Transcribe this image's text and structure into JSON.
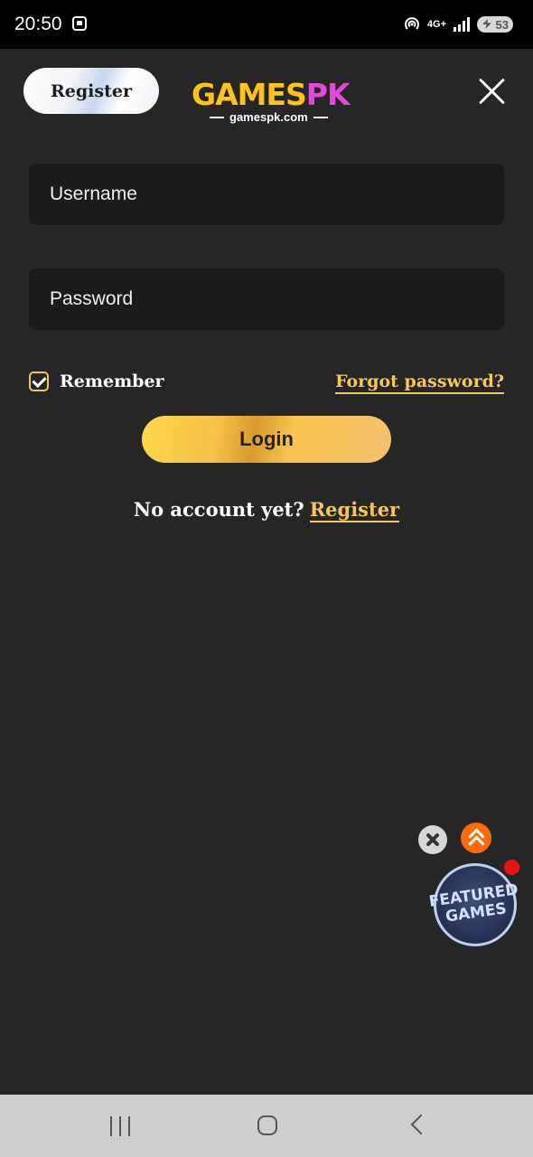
{
  "status_bar": {
    "time": "20:50",
    "network": "4G+",
    "battery": "53"
  },
  "header": {
    "register_label": "Register",
    "logo": {
      "part1": "GAMES",
      "part2": "PK",
      "domain": "gamespk.com"
    }
  },
  "form": {
    "username_placeholder": "Username",
    "password_placeholder": "Password",
    "remember_label": "Remember",
    "remember_checked": true,
    "forgot_label": "Forgot password?",
    "login_label": "Login",
    "no_account_text": "No account yet?",
    "register_link": "Register"
  },
  "floating": {
    "featured_line1": "FEATURED",
    "featured_line2": "GAMES"
  },
  "colors": {
    "background": "#262626",
    "field_bg": "#1b1b1b",
    "accent_gold": "#f6c65a",
    "scroll_top": "#ff6a00"
  }
}
